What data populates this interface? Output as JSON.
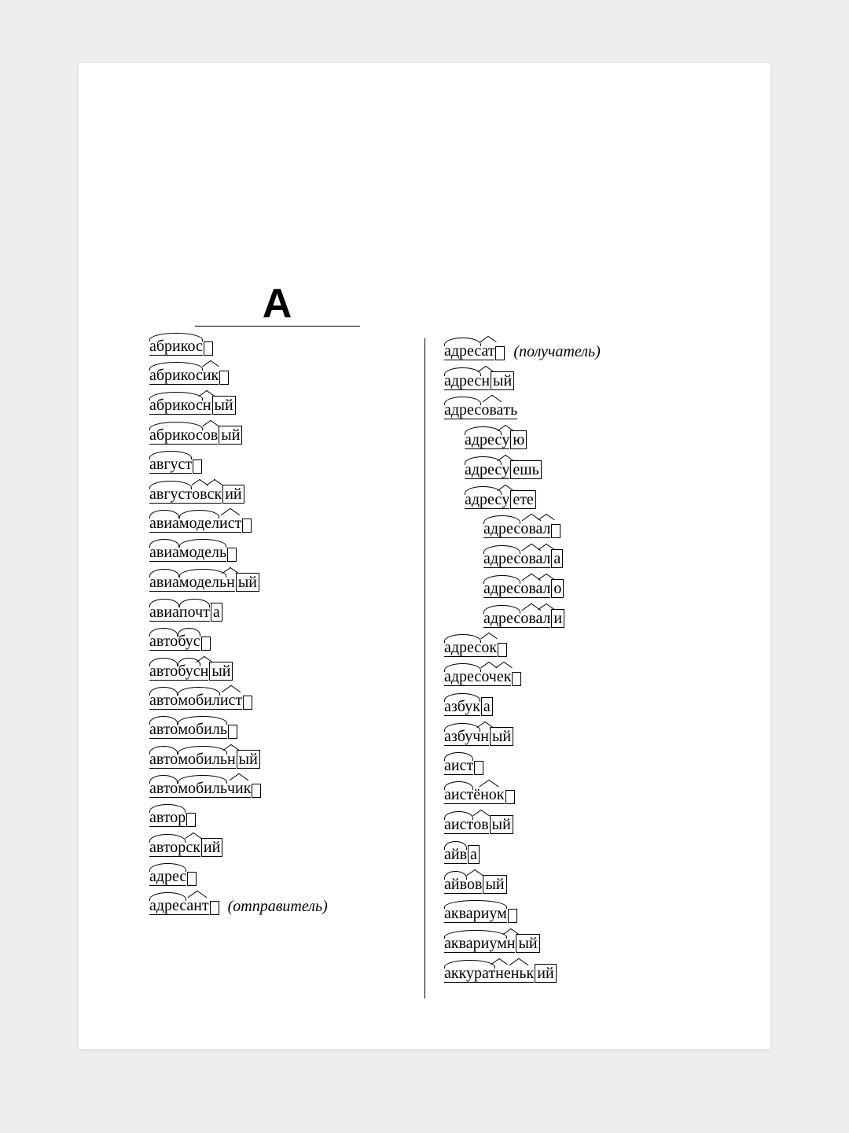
{
  "letter": "А",
  "glosses": {
    "adresant": "отправитель",
    "adresat": "получатель"
  },
  "left_entries": [
    {
      "parts": [
        {
          "t": "абрикос",
          "m": "root"
        },
        {
          "t": "",
          "m": "zero"
        }
      ]
    },
    {
      "parts": [
        {
          "t": "абрикос",
          "m": "root"
        },
        {
          "t": "ик",
          "m": "suffix"
        },
        {
          "t": "",
          "m": "zero"
        }
      ]
    },
    {
      "parts": [
        {
          "t": "абрикос",
          "m": "root"
        },
        {
          "t": "н",
          "m": "suffix"
        },
        {
          "t": "ый",
          "m": "ending"
        }
      ]
    },
    {
      "parts": [
        {
          "t": "абрикос",
          "m": "root"
        },
        {
          "t": "ов",
          "m": "suffix"
        },
        {
          "t": "ый",
          "m": "ending"
        }
      ]
    },
    {
      "parts": [
        {
          "t": "август",
          "m": "root"
        },
        {
          "t": "",
          "m": "zero"
        }
      ]
    },
    {
      "parts": [
        {
          "t": "август",
          "m": "root"
        },
        {
          "t": "ов",
          "m": "suffix"
        },
        {
          "t": "ск",
          "m": "suffix"
        },
        {
          "t": "ий",
          "m": "ending"
        }
      ]
    },
    {
      "parts": [
        {
          "t": "авиа",
          "m": "root"
        },
        {
          "t": "модел",
          "m": "root"
        },
        {
          "t": "ист",
          "m": "suffix"
        },
        {
          "t": "",
          "m": "zero"
        }
      ]
    },
    {
      "parts": [
        {
          "t": "авиа",
          "m": "root"
        },
        {
          "t": "модель",
          "m": "root"
        },
        {
          "t": "",
          "m": "zero"
        }
      ]
    },
    {
      "parts": [
        {
          "t": "авиа",
          "m": "root"
        },
        {
          "t": "модель",
          "m": "root"
        },
        {
          "t": "н",
          "m": "suffix"
        },
        {
          "t": "ый",
          "m": "ending"
        }
      ]
    },
    {
      "parts": [
        {
          "t": "авиа",
          "m": "root"
        },
        {
          "t": "почт",
          "m": "root"
        },
        {
          "t": "а",
          "m": "ending"
        }
      ]
    },
    {
      "parts": [
        {
          "t": "авто",
          "m": "root"
        },
        {
          "t": "бус",
          "m": "root"
        },
        {
          "t": "",
          "m": "zero"
        }
      ]
    },
    {
      "parts": [
        {
          "t": "авто",
          "m": "root"
        },
        {
          "t": "бус",
          "m": "root"
        },
        {
          "t": "н",
          "m": "suffix"
        },
        {
          "t": "ый",
          "m": "ending"
        }
      ]
    },
    {
      "parts": [
        {
          "t": "авто",
          "m": "root"
        },
        {
          "t": "мобил",
          "m": "root"
        },
        {
          "t": "ист",
          "m": "suffix"
        },
        {
          "t": "",
          "m": "zero"
        }
      ]
    },
    {
      "parts": [
        {
          "t": "авто",
          "m": "root"
        },
        {
          "t": "мобиль",
          "m": "root"
        },
        {
          "t": "",
          "m": "zero"
        }
      ]
    },
    {
      "parts": [
        {
          "t": "авто",
          "m": "root"
        },
        {
          "t": "мобиль",
          "m": "root"
        },
        {
          "t": "н",
          "m": "suffix"
        },
        {
          "t": "ый",
          "m": "ending"
        }
      ]
    },
    {
      "parts": [
        {
          "t": "авто",
          "m": "root"
        },
        {
          "t": "мобиль",
          "m": "root"
        },
        {
          "t": "чик",
          "m": "suffix"
        },
        {
          "t": "",
          "m": "zero"
        }
      ]
    },
    {
      "parts": [
        {
          "t": "автор",
          "m": "root"
        },
        {
          "t": "",
          "m": "zero"
        }
      ]
    },
    {
      "parts": [
        {
          "t": "автор",
          "m": "root"
        },
        {
          "t": "ск",
          "m": "suffix"
        },
        {
          "t": "ий",
          "m": "ending"
        }
      ]
    },
    {
      "parts": [
        {
          "t": "адрес",
          "m": "root"
        },
        {
          "t": "",
          "m": "zero"
        }
      ]
    },
    {
      "parts": [
        {
          "t": "адрес",
          "m": "root"
        },
        {
          "t": "ант",
          "m": "suffix"
        },
        {
          "t": "",
          "m": "zero"
        }
      ],
      "gloss": "adresant"
    }
  ],
  "right_entries": [
    {
      "parts": [
        {
          "t": "адрес",
          "m": "root"
        },
        {
          "t": "ат",
          "m": "suffix"
        },
        {
          "t": "",
          "m": "zero"
        }
      ],
      "gloss": "adresat"
    },
    {
      "parts": [
        {
          "t": "адрес",
          "m": "root"
        },
        {
          "t": "н",
          "m": "suffix"
        },
        {
          "t": "ый",
          "m": "ending"
        }
      ]
    },
    {
      "parts": [
        {
          "t": "адрес",
          "m": "root"
        },
        {
          "t": "ова",
          "m": "suffix"
        },
        {
          "t": "ть",
          "m": "plain"
        }
      ]
    },
    {
      "indent": 1,
      "parts": [
        {
          "t": "адрес",
          "m": "root"
        },
        {
          "t": "у",
          "m": "suffix"
        },
        {
          "t": "ю",
          "m": "ending"
        }
      ]
    },
    {
      "indent": 1,
      "parts": [
        {
          "t": "адрес",
          "m": "root"
        },
        {
          "t": "у",
          "m": "suffix"
        },
        {
          "t": "ешь",
          "m": "ending"
        }
      ]
    },
    {
      "indent": 1,
      "parts": [
        {
          "t": "адрес",
          "m": "root"
        },
        {
          "t": "у",
          "m": "suffix"
        },
        {
          "t": "ете",
          "m": "ending"
        }
      ]
    },
    {
      "indent": 2,
      "parts": [
        {
          "t": "адрес",
          "m": "root"
        },
        {
          "t": "ова",
          "m": "suffix"
        },
        {
          "t": "л",
          "m": "suffix"
        },
        {
          "t": "",
          "m": "zero"
        }
      ]
    },
    {
      "indent": 2,
      "parts": [
        {
          "t": "адрес",
          "m": "root"
        },
        {
          "t": "ова",
          "m": "suffix"
        },
        {
          "t": "л",
          "m": "suffix"
        },
        {
          "t": "а",
          "m": "ending"
        }
      ]
    },
    {
      "indent": 2,
      "parts": [
        {
          "t": "адрес",
          "m": "root"
        },
        {
          "t": "ова",
          "m": "suffix"
        },
        {
          "t": "л",
          "m": "suffix"
        },
        {
          "t": "о",
          "m": "ending"
        }
      ]
    },
    {
      "indent": 2,
      "parts": [
        {
          "t": "адрес",
          "m": "root"
        },
        {
          "t": "ова",
          "m": "suffix"
        },
        {
          "t": "л",
          "m": "suffix"
        },
        {
          "t": "и",
          "m": "ending"
        }
      ]
    },
    {
      "parts": [
        {
          "t": "адрес",
          "m": "root"
        },
        {
          "t": "ок",
          "m": "suffix"
        },
        {
          "t": "",
          "m": "zero"
        }
      ]
    },
    {
      "parts": [
        {
          "t": "адрес",
          "m": "root"
        },
        {
          "t": "оч",
          "m": "suffix"
        },
        {
          "t": "ек",
          "m": "suffix"
        },
        {
          "t": "",
          "m": "zero"
        }
      ]
    },
    {
      "parts": [
        {
          "t": "азбук",
          "m": "root"
        },
        {
          "t": "а",
          "m": "ending"
        }
      ]
    },
    {
      "parts": [
        {
          "t": "азбуч",
          "m": "root"
        },
        {
          "t": "н",
          "m": "suffix"
        },
        {
          "t": "ый",
          "m": "ending"
        }
      ]
    },
    {
      "parts": [
        {
          "t": "аист",
          "m": "root"
        },
        {
          "t": "",
          "m": "zero"
        }
      ]
    },
    {
      "parts": [
        {
          "t": "аист",
          "m": "root"
        },
        {
          "t": "ёнок",
          "m": "suffix"
        },
        {
          "t": "",
          "m": "zero"
        }
      ]
    },
    {
      "parts": [
        {
          "t": "аист",
          "m": "root"
        },
        {
          "t": "ов",
          "m": "suffix"
        },
        {
          "t": "ый",
          "m": "ending"
        }
      ]
    },
    {
      "parts": [
        {
          "t": "айв",
          "m": "root"
        },
        {
          "t": "а",
          "m": "ending"
        }
      ]
    },
    {
      "parts": [
        {
          "t": "айв",
          "m": "root"
        },
        {
          "t": "ов",
          "m": "suffix"
        },
        {
          "t": "ый",
          "m": "ending"
        }
      ]
    },
    {
      "parts": [
        {
          "t": "аквариум",
          "m": "root"
        },
        {
          "t": "",
          "m": "zero"
        }
      ]
    },
    {
      "parts": [
        {
          "t": "аквариум",
          "m": "root"
        },
        {
          "t": "н",
          "m": "suffix"
        },
        {
          "t": "ый",
          "m": "ending"
        }
      ]
    },
    {
      "parts": [
        {
          "t": "аккурат",
          "m": "root"
        },
        {
          "t": "н",
          "m": "suffix"
        },
        {
          "t": "еньк",
          "m": "suffix"
        },
        {
          "t": "ий",
          "m": "ending"
        }
      ]
    }
  ]
}
